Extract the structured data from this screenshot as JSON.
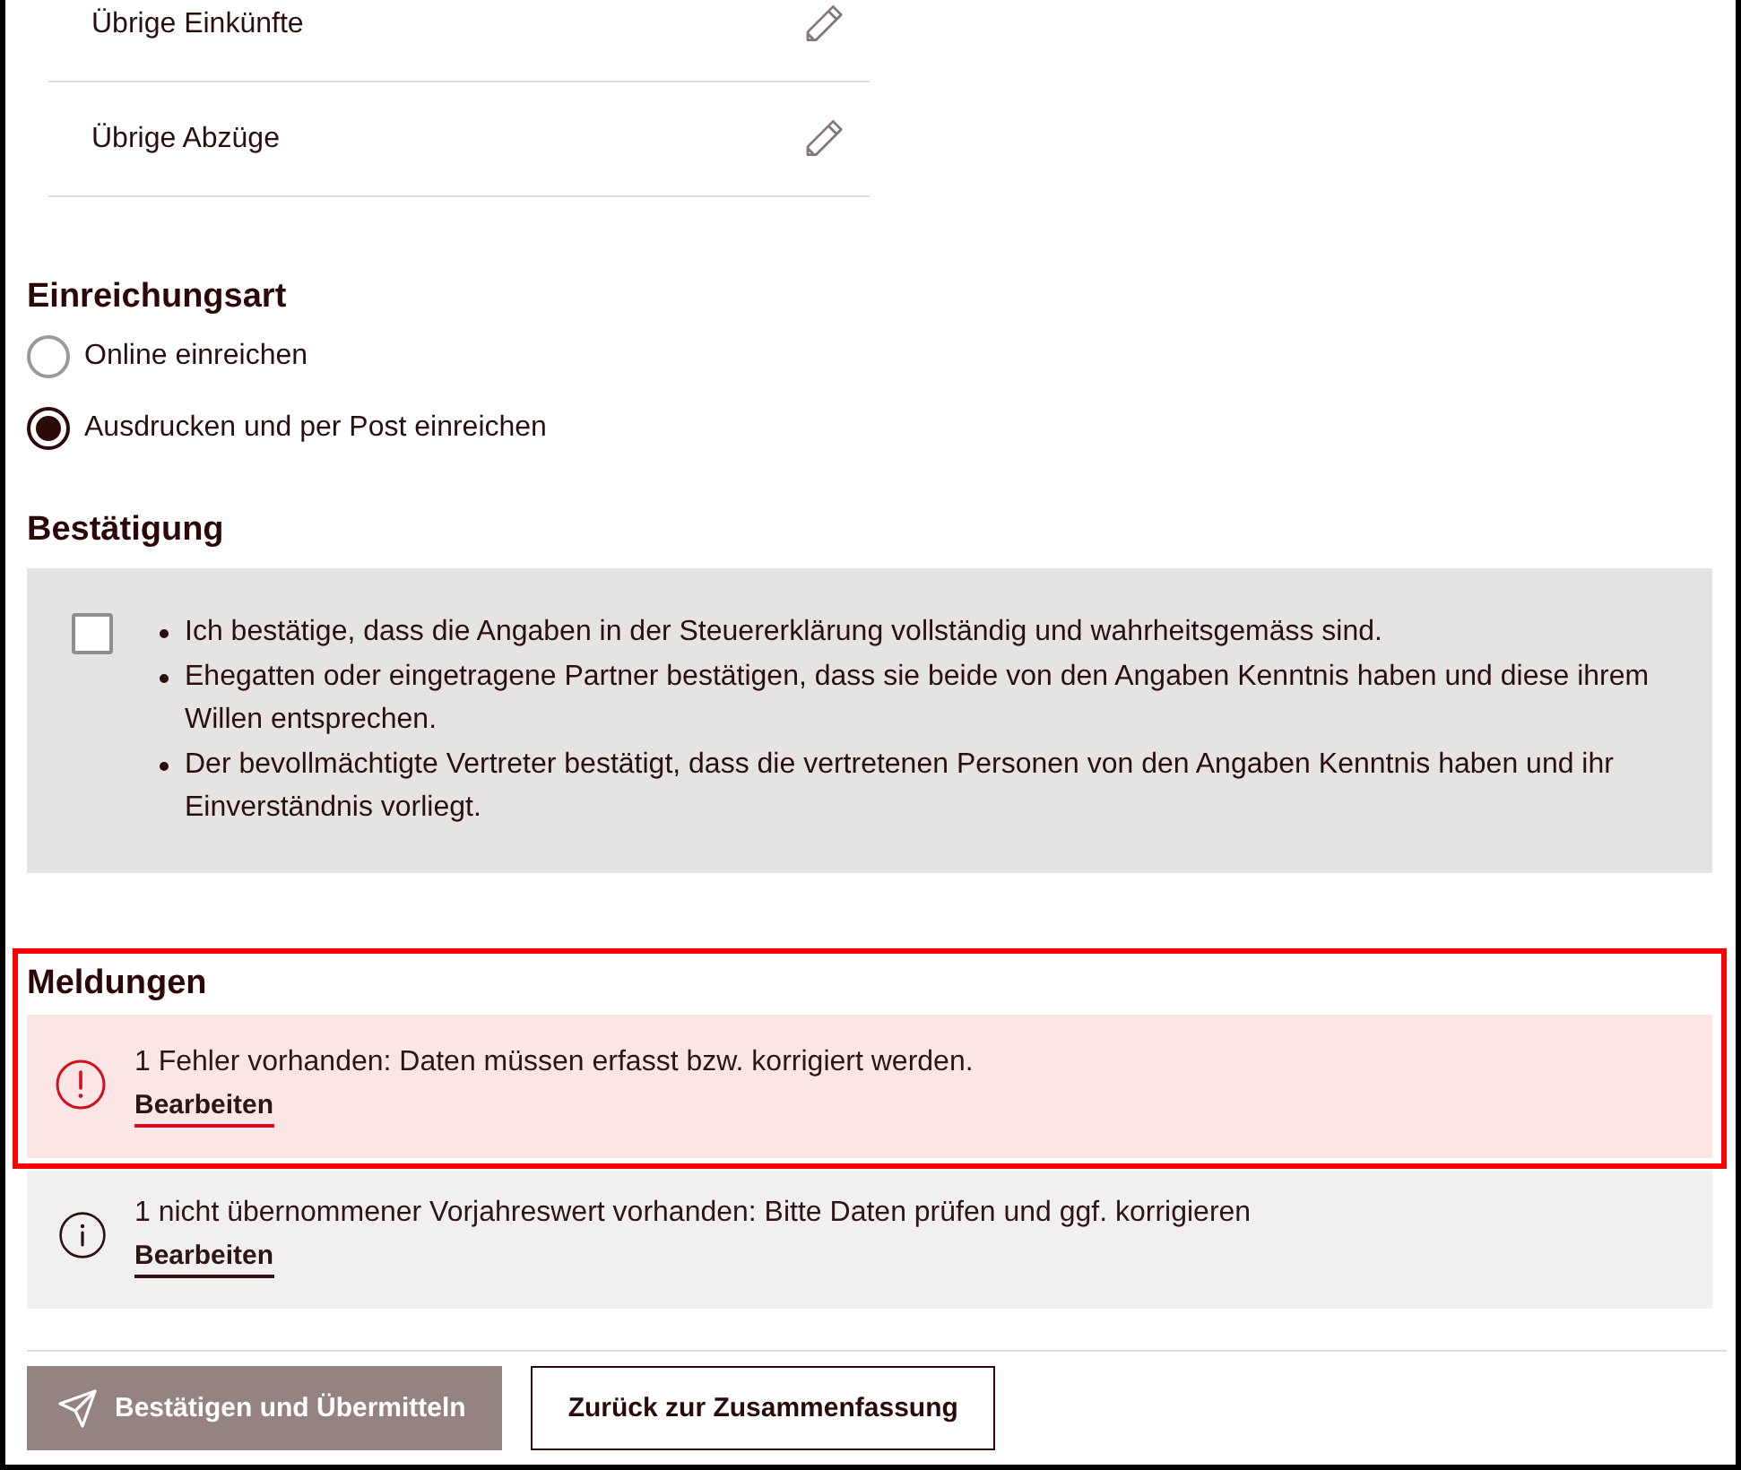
{
  "summary_rows": [
    {
      "label": "Übrige Einkünfte"
    },
    {
      "label": "Übrige Abzüge"
    }
  ],
  "submission_type": {
    "heading": "Einreichungsart",
    "options": [
      {
        "label": "Online einreichen",
        "selected": false
      },
      {
        "label": "Ausdrucken und per Post einreichen",
        "selected": true
      }
    ]
  },
  "confirmation": {
    "heading": "Bestätigung",
    "checked": false,
    "statements": [
      "Ich bestätige, dass die Angaben in der Steuererklärung vollständig und wahrheitsgemäss sind.",
      "Ehegatten oder eingetragene Partner bestätigen, dass sie beide von den Angaben Kenntnis haben und diese ihrem Willen entsprechen.",
      "Der bevollmächtigte Vertreter bestätigt, dass die vertretenen Personen von den Angaben Kenntnis haben und ihr Einverständnis vorliegt."
    ]
  },
  "messages": {
    "heading": "Meldungen",
    "items": [
      {
        "kind": "error",
        "highlighted": true,
        "text": "1 Fehler vorhanden: Daten müssen erfasst bzw. korrigiert werden.",
        "link": "Bearbeiten"
      },
      {
        "kind": "info",
        "highlighted": false,
        "text": "1 nicht übernommener Vorjahreswert vorhanden: Bitte Daten prüfen und ggf. korrigieren",
        "link": "Bearbeiten"
      }
    ]
  },
  "actions": [
    {
      "kind": "primary",
      "label": "Bestätigen und Übermitteln",
      "disabled": true
    },
    {
      "kind": "secondary",
      "label": "Zurück zur Zusammenfassung",
      "disabled": false
    }
  ]
}
